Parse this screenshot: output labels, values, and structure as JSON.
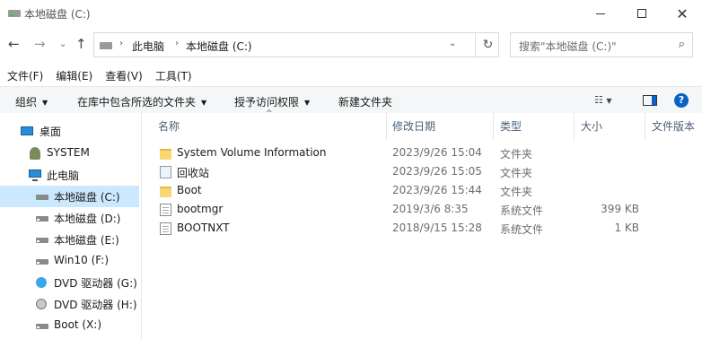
{
  "window": {
    "title": "本地磁盘 (C:)"
  },
  "address": {
    "crumbs": [
      "此电脑",
      "本地磁盘 (C:)"
    ]
  },
  "search": {
    "placeholder": "搜索\"本地磁盘 (C:)\""
  },
  "menu": [
    "文件(F)",
    "编辑(E)",
    "查看(V)",
    "工具(T)"
  ],
  "toolbar": {
    "organize": "组织",
    "include_in_library": "在库中包含所选的文件夹",
    "share_with": "授予访问权限",
    "new_folder": "新建文件夹"
  },
  "sidebar": {
    "items": [
      {
        "label": "桌面",
        "icon": "desktop-icon"
      },
      {
        "label": "SYSTEM",
        "icon": "user-icon"
      },
      {
        "label": "此电脑",
        "icon": "computer-icon"
      },
      {
        "label": "本地磁盘 (C:)",
        "icon": "system-drive-icon",
        "selected": true
      },
      {
        "label": "本地磁盘 (D:)",
        "icon": "drive-icon"
      },
      {
        "label": "本地磁盘 (E:)",
        "icon": "drive-icon"
      },
      {
        "label": "Win10 (F:)",
        "icon": "drive-icon"
      },
      {
        "label": "DVD 驱动器 (G:)",
        "icon": "dvd-icon"
      },
      {
        "label": "DVD 驱动器 (H:)",
        "icon": "dvd-drive-icon"
      },
      {
        "label": "Boot (X:)",
        "icon": "drive-icon"
      }
    ]
  },
  "columns": {
    "name": "名称",
    "date": "修改日期",
    "type": "类型",
    "size": "大小",
    "version": "文件版本"
  },
  "files": [
    {
      "name": "System Volume Information",
      "date": "2023/9/26 15:04",
      "type": "文件夹",
      "size": "",
      "icon": "folder-icon"
    },
    {
      "name": "回收站",
      "date": "2023/9/26 15:05",
      "type": "文件夹",
      "size": "",
      "icon": "recycle-bin-icon"
    },
    {
      "name": "Boot",
      "date": "2023/9/26 15:44",
      "type": "文件夹",
      "size": "",
      "icon": "folder-icon"
    },
    {
      "name": "bootmgr",
      "date": "2019/3/6 8:35",
      "type": "系统文件",
      "size": "399 KB",
      "icon": "file-icon"
    },
    {
      "name": "BOOTNXT",
      "date": "2018/9/15 15:28",
      "type": "系统文件",
      "size": "1 KB",
      "icon": "file-icon"
    }
  ]
}
